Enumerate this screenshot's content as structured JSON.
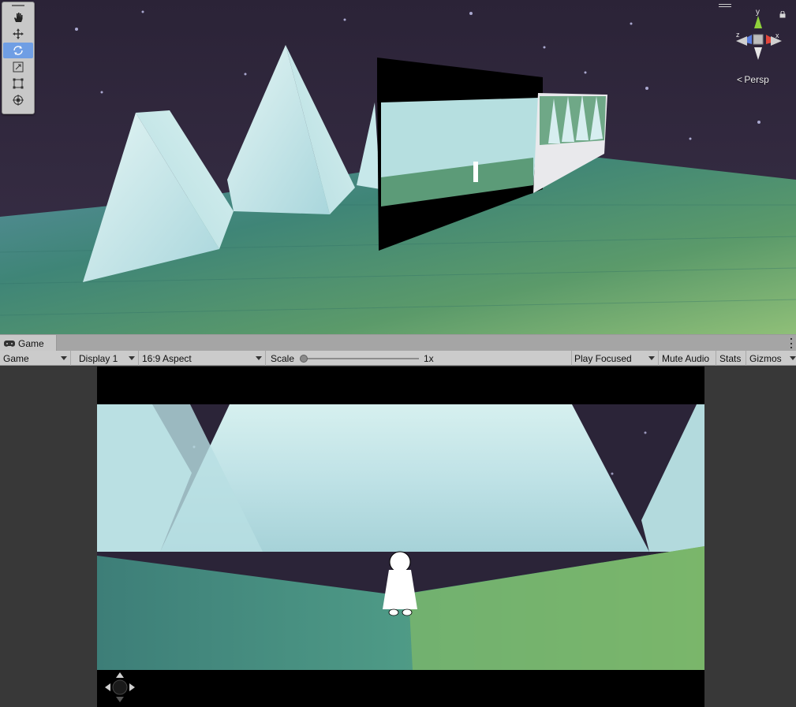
{
  "scene_view": {
    "tools": [
      {
        "name": "hand-tool",
        "icon": "hand-icon",
        "active": false
      },
      {
        "name": "move-tool",
        "icon": "move-icon",
        "active": false
      },
      {
        "name": "rotate-tool",
        "icon": "rotate-icon",
        "active": true
      },
      {
        "name": "scale-tool",
        "icon": "scale-icon",
        "active": false
      },
      {
        "name": "rect-tool",
        "icon": "rect-icon",
        "active": false
      },
      {
        "name": "transform-tool",
        "icon": "transform-icon",
        "active": false
      }
    ],
    "gizmo": {
      "y_label": "y",
      "x_label": "x",
      "z_label": "z"
    },
    "projection_label": "Persp"
  },
  "game_view": {
    "tab_label": "Game",
    "toolbar": {
      "mode": "Game",
      "display": "Display 1",
      "aspect": "16:9 Aspect",
      "scale_label": "Scale",
      "scale_value": "1x",
      "play_mode": "Play Focused",
      "mute_audio": "Mute Audio",
      "stats": "Stats",
      "gizmos": "Gizmos"
    }
  },
  "colors": {
    "toolbar_bg": "#cbcbcb",
    "active_tool": "#6f9ee4",
    "sky": "#2a2336",
    "ice": "#cfe9ec",
    "ground": "#4f8f80"
  }
}
